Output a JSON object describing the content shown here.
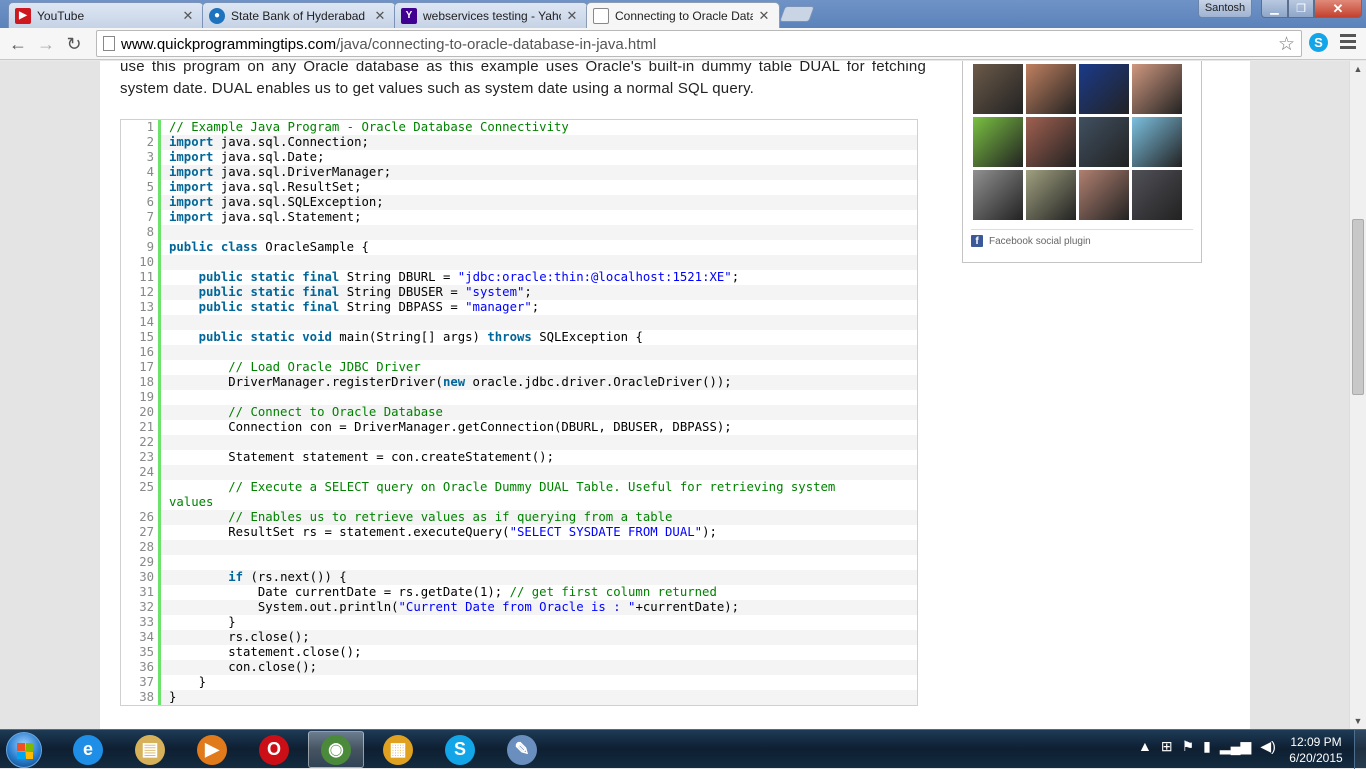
{
  "browser": {
    "tabs": [
      {
        "label": "YouTube",
        "icon": "youtube-icon",
        "color": "#cc181e"
      },
      {
        "label": "State Bank of Hyderabad",
        "icon": "bank-icon",
        "color": "#1e73be"
      },
      {
        "label": "webservices testing - Yahoo",
        "icon": "yahoo-icon",
        "color": "#400090"
      },
      {
        "label": "Connecting to Oracle Data",
        "icon": "page-icon",
        "color": "#ffffff"
      }
    ],
    "user_name": "Santosh",
    "url_host": "www.quickprogrammingtips.com",
    "url_path": "/java/connecting-to-oracle-database-in-java.html"
  },
  "article": {
    "intro": "use this program on any Oracle database as this example uses Oracle's built-in dummy table DUAL for fetching system date. DUAL enables us to get values such as system date using a normal SQL query."
  },
  "code": {
    "lines": [
      [
        [
          "cm",
          "// Example Java Program - Oracle Database Connectivity"
        ]
      ],
      [
        [
          "kw",
          "import"
        ],
        [
          "p",
          " java.sql.Connection;"
        ]
      ],
      [
        [
          "kw",
          "import"
        ],
        [
          "p",
          " java.sql.Date;"
        ]
      ],
      [
        [
          "kw",
          "import"
        ],
        [
          "p",
          " java.sql.DriverManager;"
        ]
      ],
      [
        [
          "kw",
          "import"
        ],
        [
          "p",
          " java.sql.ResultSet;"
        ]
      ],
      [
        [
          "kw",
          "import"
        ],
        [
          "p",
          " java.sql.SQLException;"
        ]
      ],
      [
        [
          "kw",
          "import"
        ],
        [
          "p",
          " java.sql.Statement;"
        ]
      ],
      [],
      [
        [
          "kw",
          "public class"
        ],
        [
          "p",
          " OracleSample {"
        ]
      ],
      [],
      [
        [
          "p",
          "    "
        ],
        [
          "kw",
          "public static final"
        ],
        [
          "p",
          " String DBURL = "
        ],
        [
          "str",
          "\"jdbc:oracle:thin:@localhost:1521:XE\""
        ],
        [
          "p",
          ";"
        ]
      ],
      [
        [
          "p",
          "    "
        ],
        [
          "kw",
          "public static final"
        ],
        [
          "p",
          " String DBUSER = "
        ],
        [
          "str",
          "\"system\""
        ],
        [
          "p",
          ";"
        ]
      ],
      [
        [
          "p",
          "    "
        ],
        [
          "kw",
          "public static final"
        ],
        [
          "p",
          " String DBPASS = "
        ],
        [
          "str",
          "\"manager\""
        ],
        [
          "p",
          ";"
        ]
      ],
      [],
      [
        [
          "p",
          "    "
        ],
        [
          "kw",
          "public static void"
        ],
        [
          "p",
          " main(String[] args) "
        ],
        [
          "kw",
          "throws"
        ],
        [
          "p",
          " SQLException {"
        ]
      ],
      [],
      [
        [
          "p",
          "        "
        ],
        [
          "cm",
          "// Load Oracle JDBC Driver"
        ]
      ],
      [
        [
          "p",
          "        DriverManager.registerDriver("
        ],
        [
          "kw",
          "new"
        ],
        [
          "p",
          " oracle.jdbc.driver.OracleDriver());"
        ]
      ],
      [],
      [
        [
          "p",
          "        "
        ],
        [
          "cm",
          "// Connect to Oracle Database"
        ]
      ],
      [
        [
          "p",
          "        Connection con = DriverManager.getConnection(DBURL, DBUSER, DBPASS);"
        ]
      ],
      [],
      [
        [
          "p",
          "        Statement statement = con.createStatement();"
        ]
      ],
      [],
      [
        [
          "p",
          "        "
        ],
        [
          "cm",
          "// Execute a SELECT query on Oracle Dummy DUAL Table. Useful for retrieving system\nvalues"
        ]
      ],
      [
        [
          "p",
          "        "
        ],
        [
          "cm",
          "// Enables us to retrieve values as if querying from a table"
        ]
      ],
      [
        [
          "p",
          "        ResultSet rs = statement.executeQuery("
        ],
        [
          "str",
          "\"SELECT SYSDATE FROM DUAL\""
        ],
        [
          "p",
          ");"
        ]
      ],
      [],
      [],
      [
        [
          "p",
          "        "
        ],
        [
          "kw",
          "if"
        ],
        [
          "p",
          " (rs.next()) {"
        ]
      ],
      [
        [
          "p",
          "            Date currentDate = rs.getDate(1); "
        ],
        [
          "cm",
          "// get first column returned"
        ]
      ],
      [
        [
          "p",
          "            System.out.println("
        ],
        [
          "str",
          "\"Current Date from Oracle is : \""
        ],
        [
          "p",
          "+currentDate);"
        ]
      ],
      [
        [
          "p",
          "        }"
        ]
      ],
      [
        [
          "p",
          "        rs.close();"
        ]
      ],
      [
        [
          "p",
          "        statement.close();"
        ]
      ],
      [
        [
          "p",
          "        con.close();"
        ]
      ],
      [
        [
          "p",
          "    }"
        ]
      ],
      [
        [
          "p",
          "}"
        ]
      ]
    ]
  },
  "sidebar": {
    "fb_plugin_label": "Facebook social plugin",
    "fans": [
      {
        "name": "fan-1",
        "color": "#6b5a4a"
      },
      {
        "name": "fan-2",
        "color": "#c08060"
      },
      {
        "name": "fan-3",
        "color": "#1a3a8a"
      },
      {
        "name": "fan-4",
        "color": "#d09880"
      },
      {
        "name": "fan-5",
        "color": "#7ac142"
      },
      {
        "name": "fan-6",
        "color": "#a06050"
      },
      {
        "name": "fan-7",
        "color": "#405060"
      },
      {
        "name": "fan-8",
        "color": "#7cc0e0"
      },
      {
        "name": "fan-9",
        "color": "#909090"
      },
      {
        "name": "fan-10",
        "color": "#a0a080"
      },
      {
        "name": "fan-11",
        "color": "#b08070"
      },
      {
        "name": "fan-12",
        "color": "#505058"
      }
    ]
  },
  "taskbar": {
    "apps": [
      {
        "name": "internet-explorer",
        "icon": "ie-icon",
        "glyph": "e",
        "color": "#1e8ee6"
      },
      {
        "name": "file-explorer",
        "icon": "folder-icon",
        "glyph": "▤",
        "color": "#d6b15a"
      },
      {
        "name": "media-player",
        "icon": "media-player-icon",
        "glyph": "▶",
        "color": "#e07a1a"
      },
      {
        "name": "opera",
        "icon": "opera-icon",
        "glyph": "O",
        "color": "#cc0f16"
      },
      {
        "name": "chrome",
        "icon": "chrome-icon",
        "glyph": "◉",
        "color": "#4a8a3a"
      },
      {
        "name": "apps-grid",
        "icon": "grid-icon",
        "glyph": "▦",
        "color": "#e0a020"
      },
      {
        "name": "skype",
        "icon": "skype-icon",
        "glyph": "S",
        "color": "#12a5e8"
      },
      {
        "name": "paint",
        "icon": "paint-icon",
        "glyph": "✎",
        "color": "#6a8fbf"
      }
    ],
    "time": "12:09 PM",
    "date": "6/20/2015"
  }
}
